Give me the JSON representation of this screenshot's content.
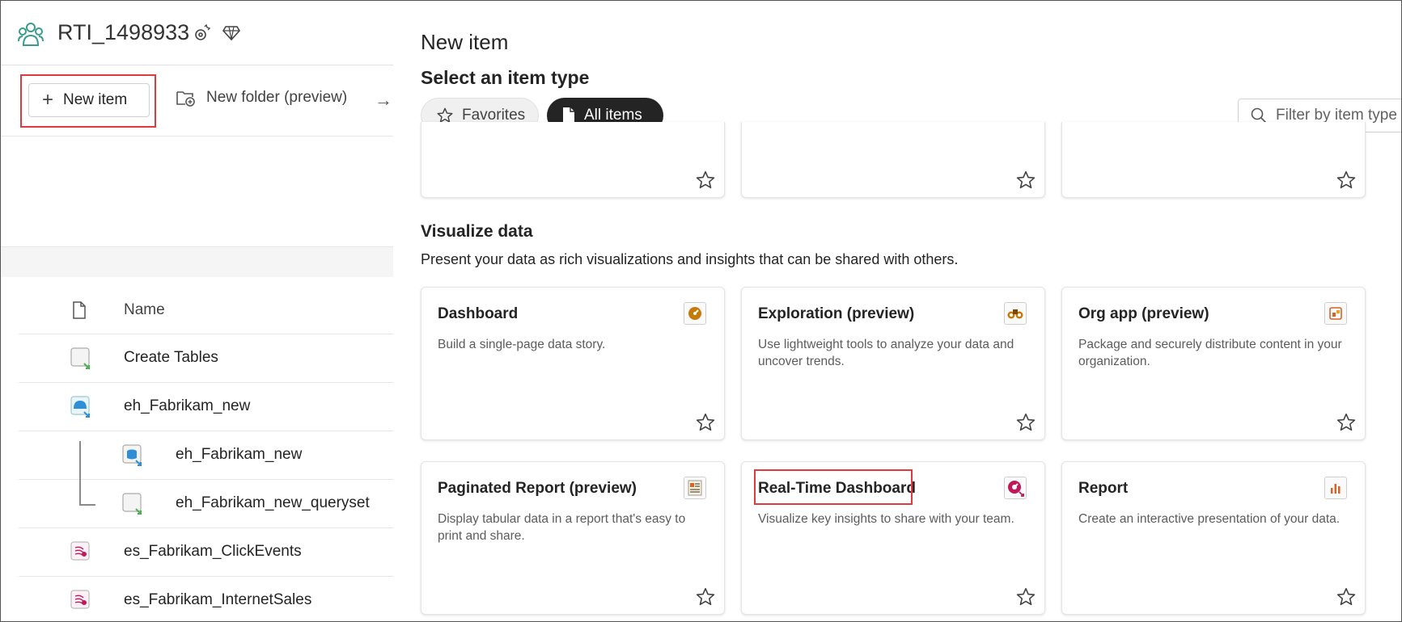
{
  "workspace": {
    "title": "RTI_1498933",
    "toolbar": {
      "new_item_label": "New item",
      "new_folder_label": "New folder (preview)"
    },
    "list": {
      "header_name": "Name",
      "items": [
        {
          "label": "Create Tables",
          "icon": "notebook-icon"
        },
        {
          "label": "eh_Fabrikam_new",
          "icon": "eventhouse-icon"
        },
        {
          "label": "eh_Fabrikam_new",
          "icon": "kql-database-icon"
        },
        {
          "label": "eh_Fabrikam_new_queryset",
          "icon": "queryset-icon"
        },
        {
          "label": "es_Fabrikam_ClickEvents",
          "icon": "eventstream-icon"
        },
        {
          "label": "es_Fabrikam_InternetSales",
          "icon": "eventstream-icon"
        }
      ]
    }
  },
  "panel": {
    "title": "New item",
    "subtitle": "Select an item type",
    "tabs": {
      "favorites": "Favorites",
      "all_items": "All items"
    },
    "filter_placeholder": "Filter by item type",
    "section": {
      "title": "Visualize data",
      "description": "Present your data as rich visualizations and insights that can be shared with others."
    },
    "cards": [
      {
        "title": "Dashboard",
        "description": "Build a single-page data story.",
        "icon": "dashboard-icon"
      },
      {
        "title": "Exploration (preview)",
        "description": "Use lightweight tools to analyze your data and uncover trends.",
        "icon": "binoculars-icon"
      },
      {
        "title": "Org app (preview)",
        "description": "Package and securely distribute content in your organization.",
        "icon": "org-app-icon"
      },
      {
        "title": "Paginated Report (preview)",
        "description": "Display tabular data in a report that's easy to print and share.",
        "icon": "paginated-report-icon"
      },
      {
        "title": "Real-Time Dashboard",
        "description": "Visualize key insights to share with your team.",
        "icon": "realtime-dashboard-icon"
      },
      {
        "title": "Report",
        "description": "Create an interactive presentation of your data.",
        "icon": "report-icon"
      }
    ]
  },
  "colors": {
    "highlight": "#e0393e",
    "pill_active": "#242424",
    "workspace_icon": "#3a9c8c"
  }
}
